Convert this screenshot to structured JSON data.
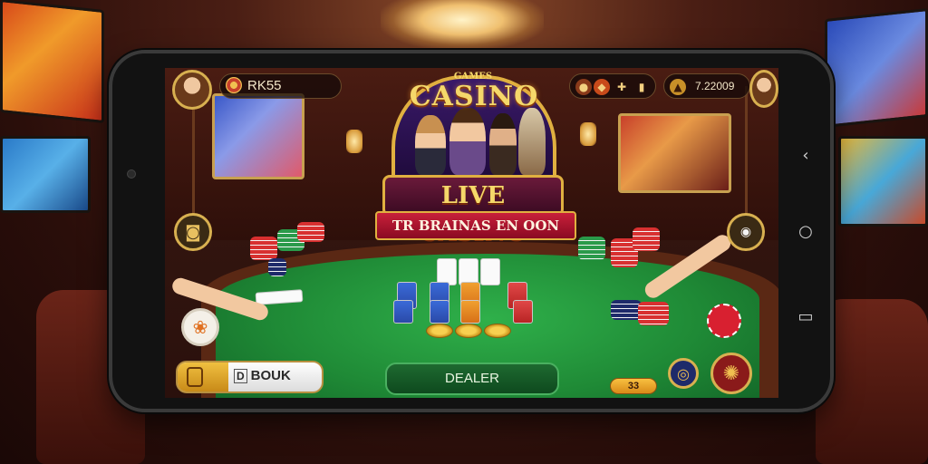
{
  "hud": {
    "coins": "RK55",
    "right_value": "7.22009",
    "icons": [
      "coin-icon",
      "gem-icon",
      "puzzle-icon",
      "cards-icon",
      "gift-icon"
    ]
  },
  "logo": {
    "subtitle": "GAMES",
    "title": "CASINO",
    "live_banner": "LIVE CASINO",
    "tagline": "TR BRAINAS EN OON"
  },
  "bottom": {
    "balance_label": "BOUK",
    "balance_icon_letter": "D",
    "dealer_button": "DEALER",
    "bet_value": "33"
  },
  "navbar": {
    "back": "‹",
    "home": "○",
    "recents": "▭"
  },
  "colors": {
    "felt": "#1f8a36",
    "gold": "#e0b040",
    "banner_red": "#c8203a"
  }
}
